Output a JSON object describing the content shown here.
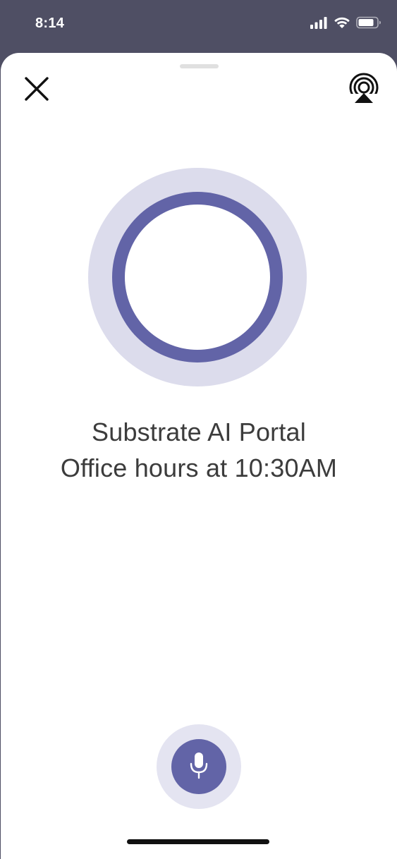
{
  "status_bar": {
    "time": "8:14",
    "icons": [
      "cellular-signal-icon",
      "wifi-icon",
      "battery-icon"
    ]
  },
  "header": {
    "close_icon": "close-icon",
    "cast_icon": "airplay-icon"
  },
  "listening_orb": {
    "state": "listening",
    "colors": {
      "outer_halo": "#dcdcec",
      "ring": "#6264a7",
      "center": "#ffffff"
    }
  },
  "caption": {
    "line1": "Substrate AI Portal",
    "line2": "Office hours at 10:30AM"
  },
  "mic": {
    "icon": "microphone-icon",
    "colors": {
      "halo": "#e4e4f1",
      "button": "#6264a7"
    }
  },
  "theme": {
    "status_bar_bg": "#4f4f64",
    "sheet_bg": "#ffffff",
    "accent": "#6264a7",
    "text": "#3c3c3c"
  }
}
